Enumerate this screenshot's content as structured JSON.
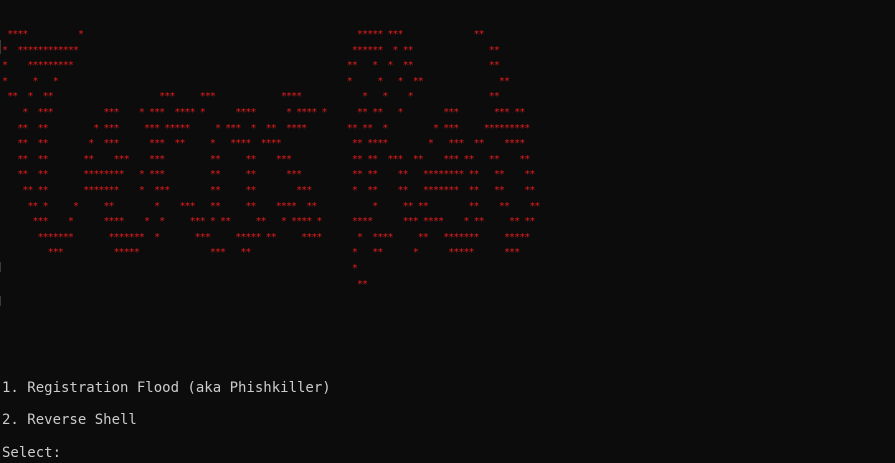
{
  "banner": {
    "art": " ****          *                                                      ***** ***              **\n*  ************                                                      ******  * **               **\n*    *********                                                      **   *  *  **               **\n*     *   *                                                         *     *   *  **               **\n **  *  **                     ***     ***             ****            *   *    *               **\n    *  ***          ***    * ***  **** *      ****      * **** *      ** **   *        ***       *** **\n   **  **         * ***     *** *****     * ***  *  **  ****        ** **  *         * ***     *********\n   **  **        *  ***      ***  **     *   ****  ****              ** ****        *   ***  **    ****\n   **  **       **    ***    ***         **     **    ***            ** **  ***  **    *** **   **    **\n   **  **       ********   * ***         **     **      ***          ** **    **   ******** **   **    **\n    ** **       *******    *  ***        **     **        ***        *  **    **   *******  **   **    **\n     ** *     *     **        *    ***   **     **    ****  **           *     ** **        **    **    **\n      ***    *      ****    *  *     *** * **     **   * **** *      ****      *** ****    * **     ** **\n       *******       *******  *       ***     ***** **     ****       *  ****     **   *******     *****\n         ***          *****              ***   **                    *   **      *      *****      ***\n                                                                     *\n                                                                      **"
  },
  "menu": {
    "option_1": "1. Registration Flood (aka Phishkiller)",
    "option_2": "2. Reverse Shell",
    "prompt": "Select:"
  },
  "colors": {
    "background": "#0c0c0c",
    "banner_red": "#e31d1d",
    "text": "#cccccc"
  }
}
